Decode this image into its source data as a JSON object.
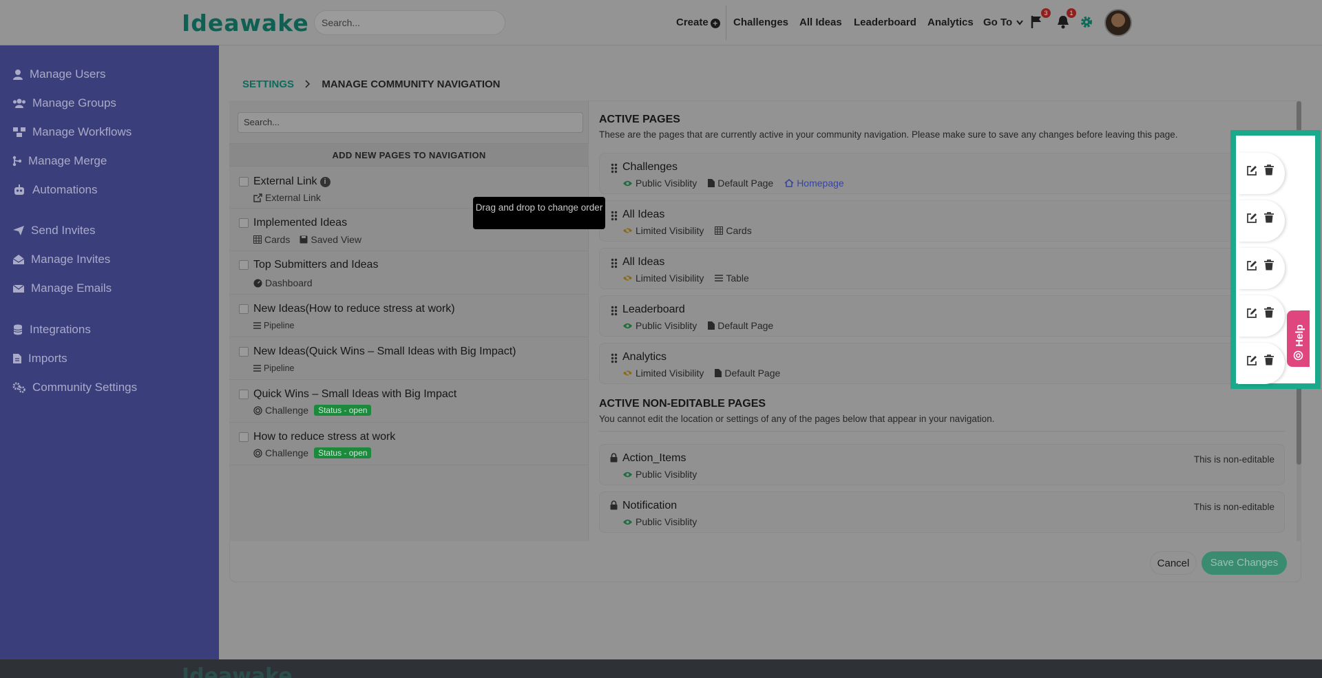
{
  "header": {
    "logo": "Ideawake",
    "search_placeholder": "Search...",
    "nav": {
      "create": "Create",
      "challenges": "Challenges",
      "all_ideas": "All Ideas",
      "leaderboard": "Leaderboard",
      "analytics": "Analytics",
      "goto": "Go To"
    },
    "flag_badge": "3",
    "bell_badge": "1"
  },
  "sidebar": {
    "items": [
      {
        "label": "Manage Users",
        "icon": "user-icon"
      },
      {
        "label": "Manage Groups",
        "icon": "users-icon"
      },
      {
        "label": "Manage Workflows",
        "icon": "workflow-icon"
      },
      {
        "label": "Manage Merge",
        "icon": "merge-icon"
      },
      {
        "label": "Automations",
        "icon": "robot-icon"
      },
      {
        "label": "Send Invites",
        "icon": "paper-plane-icon"
      },
      {
        "label": "Manage Invites",
        "icon": "envelope-open-icon"
      },
      {
        "label": "Manage Emails",
        "icon": "envelope-icon"
      },
      {
        "label": "Integrations",
        "icon": "database-icon"
      },
      {
        "label": "Imports",
        "icon": "file-icon"
      },
      {
        "label": "Community Settings",
        "icon": "cogs-icon"
      }
    ]
  },
  "breadcrumb": {
    "settings": "SETTINGS",
    "current": "MANAGE COMMUNITY NAVIGATION"
  },
  "left_panel": {
    "search_placeholder": "Search...",
    "heading": "ADD NEW PAGES TO NAVIGATION",
    "items": [
      {
        "title": "External Link",
        "sub": [
          "External Link"
        ]
      },
      {
        "title": "Implemented Ideas",
        "sub": [
          "Cards",
          "Saved View"
        ]
      },
      {
        "title": "Top Submitters and Ideas",
        "sub": [
          "Dashboard"
        ]
      },
      {
        "title": "New Ideas(How to reduce stress at work)",
        "sub": [
          "Pipeline"
        ]
      },
      {
        "title": "New Ideas(Quick Wins – Small Ideas with Big Impact)",
        "sub": [
          "Pipeline"
        ]
      },
      {
        "title": "Quick Wins – Small Ideas with Big Impact",
        "sub": [
          "Challenge"
        ],
        "status": "Status - open"
      },
      {
        "title": "How to reduce stress at work",
        "sub": [
          "Challenge"
        ],
        "status": "Status - open"
      }
    ]
  },
  "tooltip": "Drag and drop to change order",
  "active_pages": {
    "title": "ACTIVE PAGES",
    "description": "These are the pages that are currently active in your community navigation. Please make sure to save any changes before leaving this page.",
    "items": [
      {
        "title": "Challenges",
        "visibility": "Public Visiblity",
        "type": "Default Page",
        "extra": "Homepage"
      },
      {
        "title": "All Ideas",
        "visibility": "Limited Visibility",
        "type": "Cards"
      },
      {
        "title": "All Ideas",
        "visibility": "Limited Visibility",
        "type": "Table"
      },
      {
        "title": "Leaderboard",
        "visibility": "Public Visiblity",
        "type": "Default Page"
      },
      {
        "title": "Analytics",
        "visibility": "Limited Visibility",
        "type": "Default Page"
      }
    ]
  },
  "non_editable": {
    "title": "ACTIVE NON-EDITABLE PAGES",
    "description": "You cannot edit the location or settings of any of the pages below that appear in your navigation.",
    "note": "This is non-editable",
    "items": [
      {
        "title": "Action_Items",
        "visibility": "Public Visiblity"
      },
      {
        "title": "Notification",
        "visibility": "Public Visiblity"
      }
    ]
  },
  "help_label": "Help",
  "buttons": {
    "cancel": "Cancel",
    "save": "Save Changes"
  },
  "colors": {
    "accent": "#1aa98a",
    "sidebar": "#3a3e7a",
    "status_open": "#1c8a3d",
    "help": "#e0467e"
  }
}
